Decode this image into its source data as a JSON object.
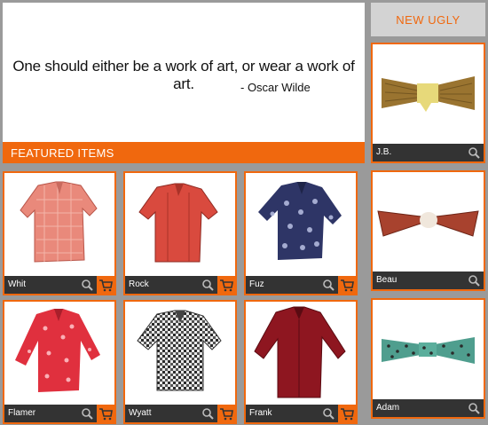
{
  "quote": {
    "text": "One should either be a work of art, or wear a work of art.",
    "author": "-  Oscar Wilde"
  },
  "featured": {
    "title": "FEATURED ITEMS",
    "items": [
      {
        "name": "Whit",
        "icon": "shirt-pink-plaid"
      },
      {
        "name": "Rock",
        "icon": "shirt-red"
      },
      {
        "name": "Fuz",
        "icon": "shirt-navy-floral"
      },
      {
        "name": "Flamer",
        "icon": "shirt-red-paisley"
      },
      {
        "name": "Wyatt",
        "icon": "shirt-black-white-check"
      },
      {
        "name": "Frank",
        "icon": "shirt-dark-red"
      }
    ]
  },
  "new_ugly": {
    "label": "NEW UGLY",
    "items": [
      {
        "name": "J.B.",
        "icon": "bowtie-woven-yellow"
      },
      {
        "name": "Beau",
        "icon": "bowtie-rust"
      },
      {
        "name": "Adam",
        "icon": "bowtie-teal-dots"
      }
    ]
  },
  "colors": {
    "accent": "#f0680e",
    "bar": "#333333",
    "background": "#9a9a9a"
  }
}
